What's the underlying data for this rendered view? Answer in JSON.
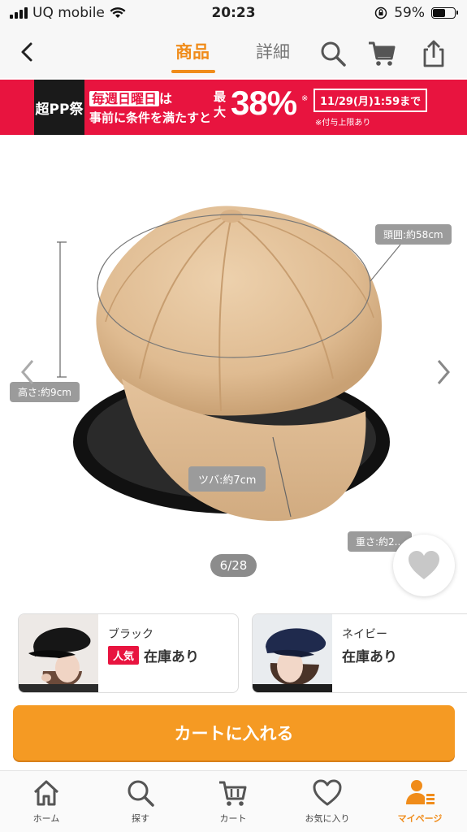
{
  "status_bar": {
    "carrier": "UQ mobile",
    "time": "20:23",
    "battery": "59%",
    "battery_level": 0.59
  },
  "header": {
    "tabs": [
      {
        "label": "商品",
        "active": true
      },
      {
        "label": "詳細",
        "active": false
      }
    ],
    "icons": [
      "back-icon",
      "search-icon",
      "cart-icon",
      "share-icon"
    ],
    "accent_color": "#f08c1a"
  },
  "banner": {
    "logo": "超PP祭",
    "line1_highlight": "毎週日曜日",
    "line1_suffix": "は",
    "line2": "事前に条件を満たすと",
    "max_label": "最大",
    "percent": "38%",
    "percent_mark": "※",
    "date": "11/29(月)1:59まで",
    "note": "※付与上限あり",
    "color": "#e8143f"
  },
  "gallery": {
    "labels": {
      "circumference": "頭囲:約58cm",
      "height": "高さ:約9cm",
      "brim": "ツバ:約7cm",
      "weight": "重さ:約2..."
    },
    "counter": "6/28"
  },
  "variants": [
    {
      "name": "ブラック",
      "badge": "人気",
      "stock": "在庫あり"
    },
    {
      "name": "ネイビー",
      "badge": "",
      "stock": "在庫あり"
    }
  ],
  "cart_button": {
    "label": "カートに入れる",
    "color": "#f59a23"
  },
  "tabbar": [
    {
      "label": "ホーム",
      "icon": "home-icon",
      "active": false
    },
    {
      "label": "探す",
      "icon": "search-icon",
      "active": false
    },
    {
      "label": "カート",
      "icon": "cart-icon",
      "active": false
    },
    {
      "label": "お気に入り",
      "icon": "heart-icon",
      "active": false
    },
    {
      "label": "マイページ",
      "icon": "user-icon",
      "active": true
    }
  ]
}
